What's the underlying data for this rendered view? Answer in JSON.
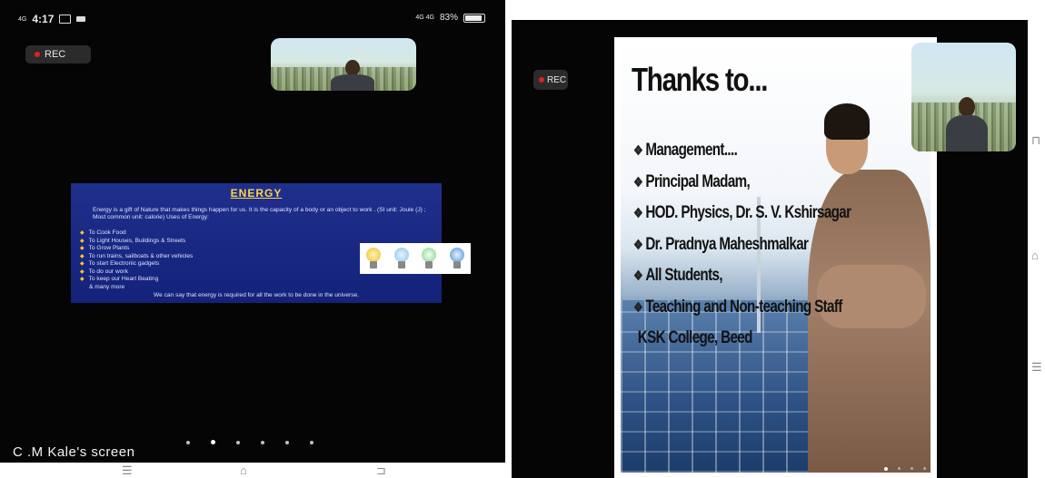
{
  "left_screen": {
    "status_bar": {
      "network": "4G",
      "time": "4:17",
      "signal_text": "4G 4G",
      "battery_text": "83%",
      "battery_level": 0.83
    },
    "rec_label": "REC",
    "slide": {
      "title": "ENERGY",
      "intro": "Energy is a gift of Nature that makes things happen for us. It is the capacity of a body or an object to work . (SI unit: Joule (J) ; Most common unit: calorie) Uses of Energy:",
      "uses": [
        "To Cook Food",
        "To Light Houses, Buildings & Streets",
        "To Grow Plants",
        "To run trains, sailboats & other vehicles",
        "To start Electronic gadgets",
        "To do our work",
        "To keep our Heart Beating",
        "& many more"
      ],
      "footer": "We can say that energy is required for all the work to be done in the universe."
    },
    "screen_label": "C .M Kale's screen",
    "page_dots_count": 6,
    "active_dot_index": 1,
    "nav_icons": [
      "menu-icon",
      "home-icon",
      "back-icon"
    ]
  },
  "right_screen": {
    "rec_label": "REC",
    "slide": {
      "title": "Thanks to...",
      "items": [
        "Management....",
        "Principal Madam,",
        "HOD. Physics, Dr. S. V. Kshirsagar",
        "Dr. Pradnya Maheshmalkar",
        "All Students,",
        "Teaching and Non-teaching Staff"
      ],
      "continuation": "KSK College, Beed"
    },
    "side_nav_icons": [
      "back-icon",
      "home-icon",
      "menu-icon"
    ]
  },
  "colors": {
    "rec_dot": "#e0201f",
    "slide_bg": "#1f2f8c",
    "slide_title": "#ffd44a",
    "bullet": "#ffc52a"
  }
}
